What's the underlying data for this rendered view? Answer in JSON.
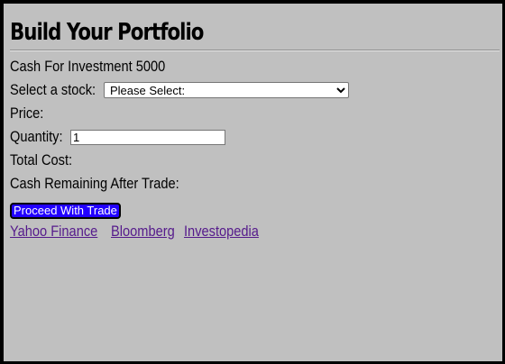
{
  "header": {
    "title": "Build Your Portfolio"
  },
  "cash": {
    "label": "Cash For Investment",
    "amount": "5000"
  },
  "stock": {
    "label": "Select a stock:",
    "selected": "Please Select:"
  },
  "price": {
    "label": "Price:"
  },
  "quantity": {
    "label": "Quantity:",
    "value": "1"
  },
  "total": {
    "label": "Total Cost:"
  },
  "remaining": {
    "label": "Cash Remaining After Trade:"
  },
  "actions": {
    "proceed_label": "Proceed With Trade",
    "button_color": "#2200ff"
  },
  "links": [
    {
      "label": "Yahoo Finance"
    },
    {
      "label": "Bloomberg"
    },
    {
      "label": "Investopedia"
    }
  ],
  "colors": {
    "background": "#c0c0c0",
    "link": "#551a8b"
  }
}
